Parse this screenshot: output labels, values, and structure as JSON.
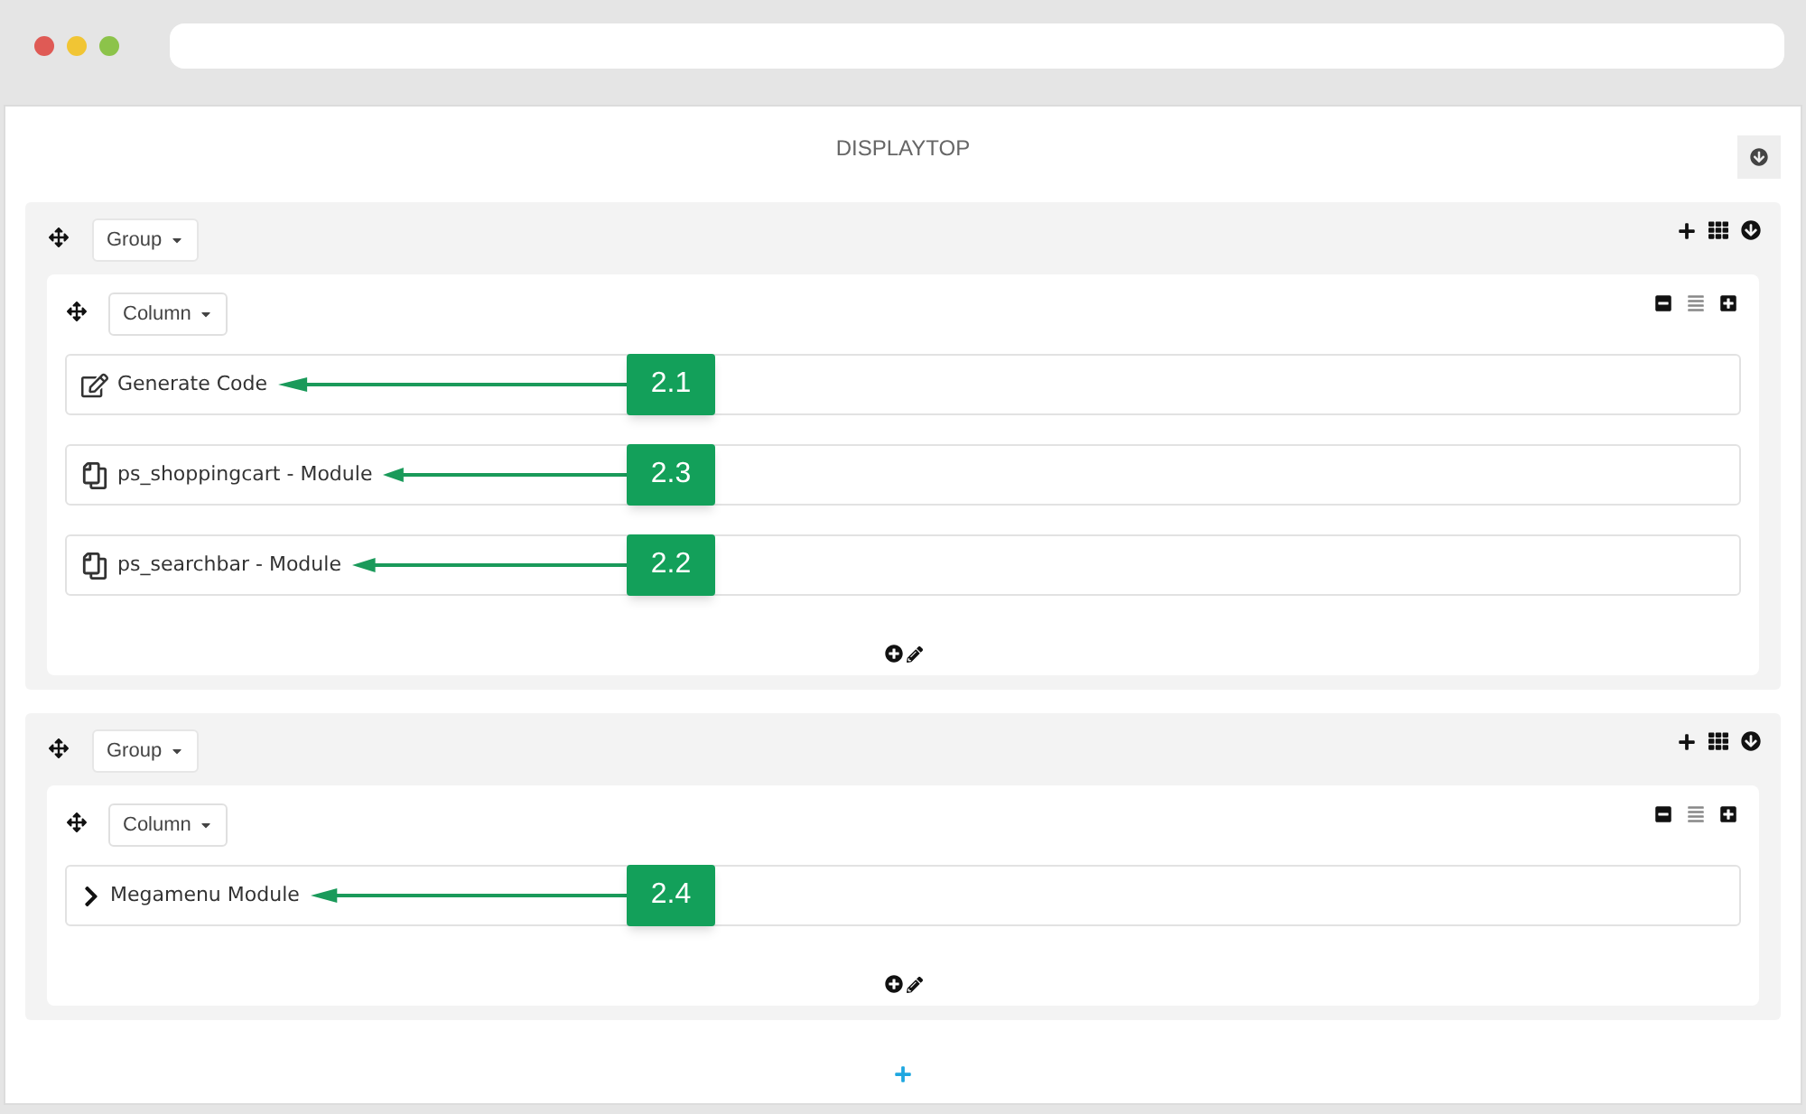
{
  "title": "DISPLAYTOP",
  "groups": [
    {
      "label": "Group",
      "columns": [
        {
          "label": "Column",
          "items": [
            {
              "kind": "edit",
              "label": "Generate Code",
              "callout": "2.1"
            },
            {
              "kind": "module",
              "label": "ps_shoppingcart - Module",
              "callout": "2.3"
            },
            {
              "kind": "module",
              "label": "ps_searchbar - Module",
              "callout": "2.2"
            }
          ]
        }
      ]
    },
    {
      "label": "Group",
      "columns": [
        {
          "label": "Column",
          "items": [
            {
              "kind": "menu",
              "label": "Megamenu Module",
              "callout": "2.4"
            }
          ]
        }
      ]
    }
  ]
}
